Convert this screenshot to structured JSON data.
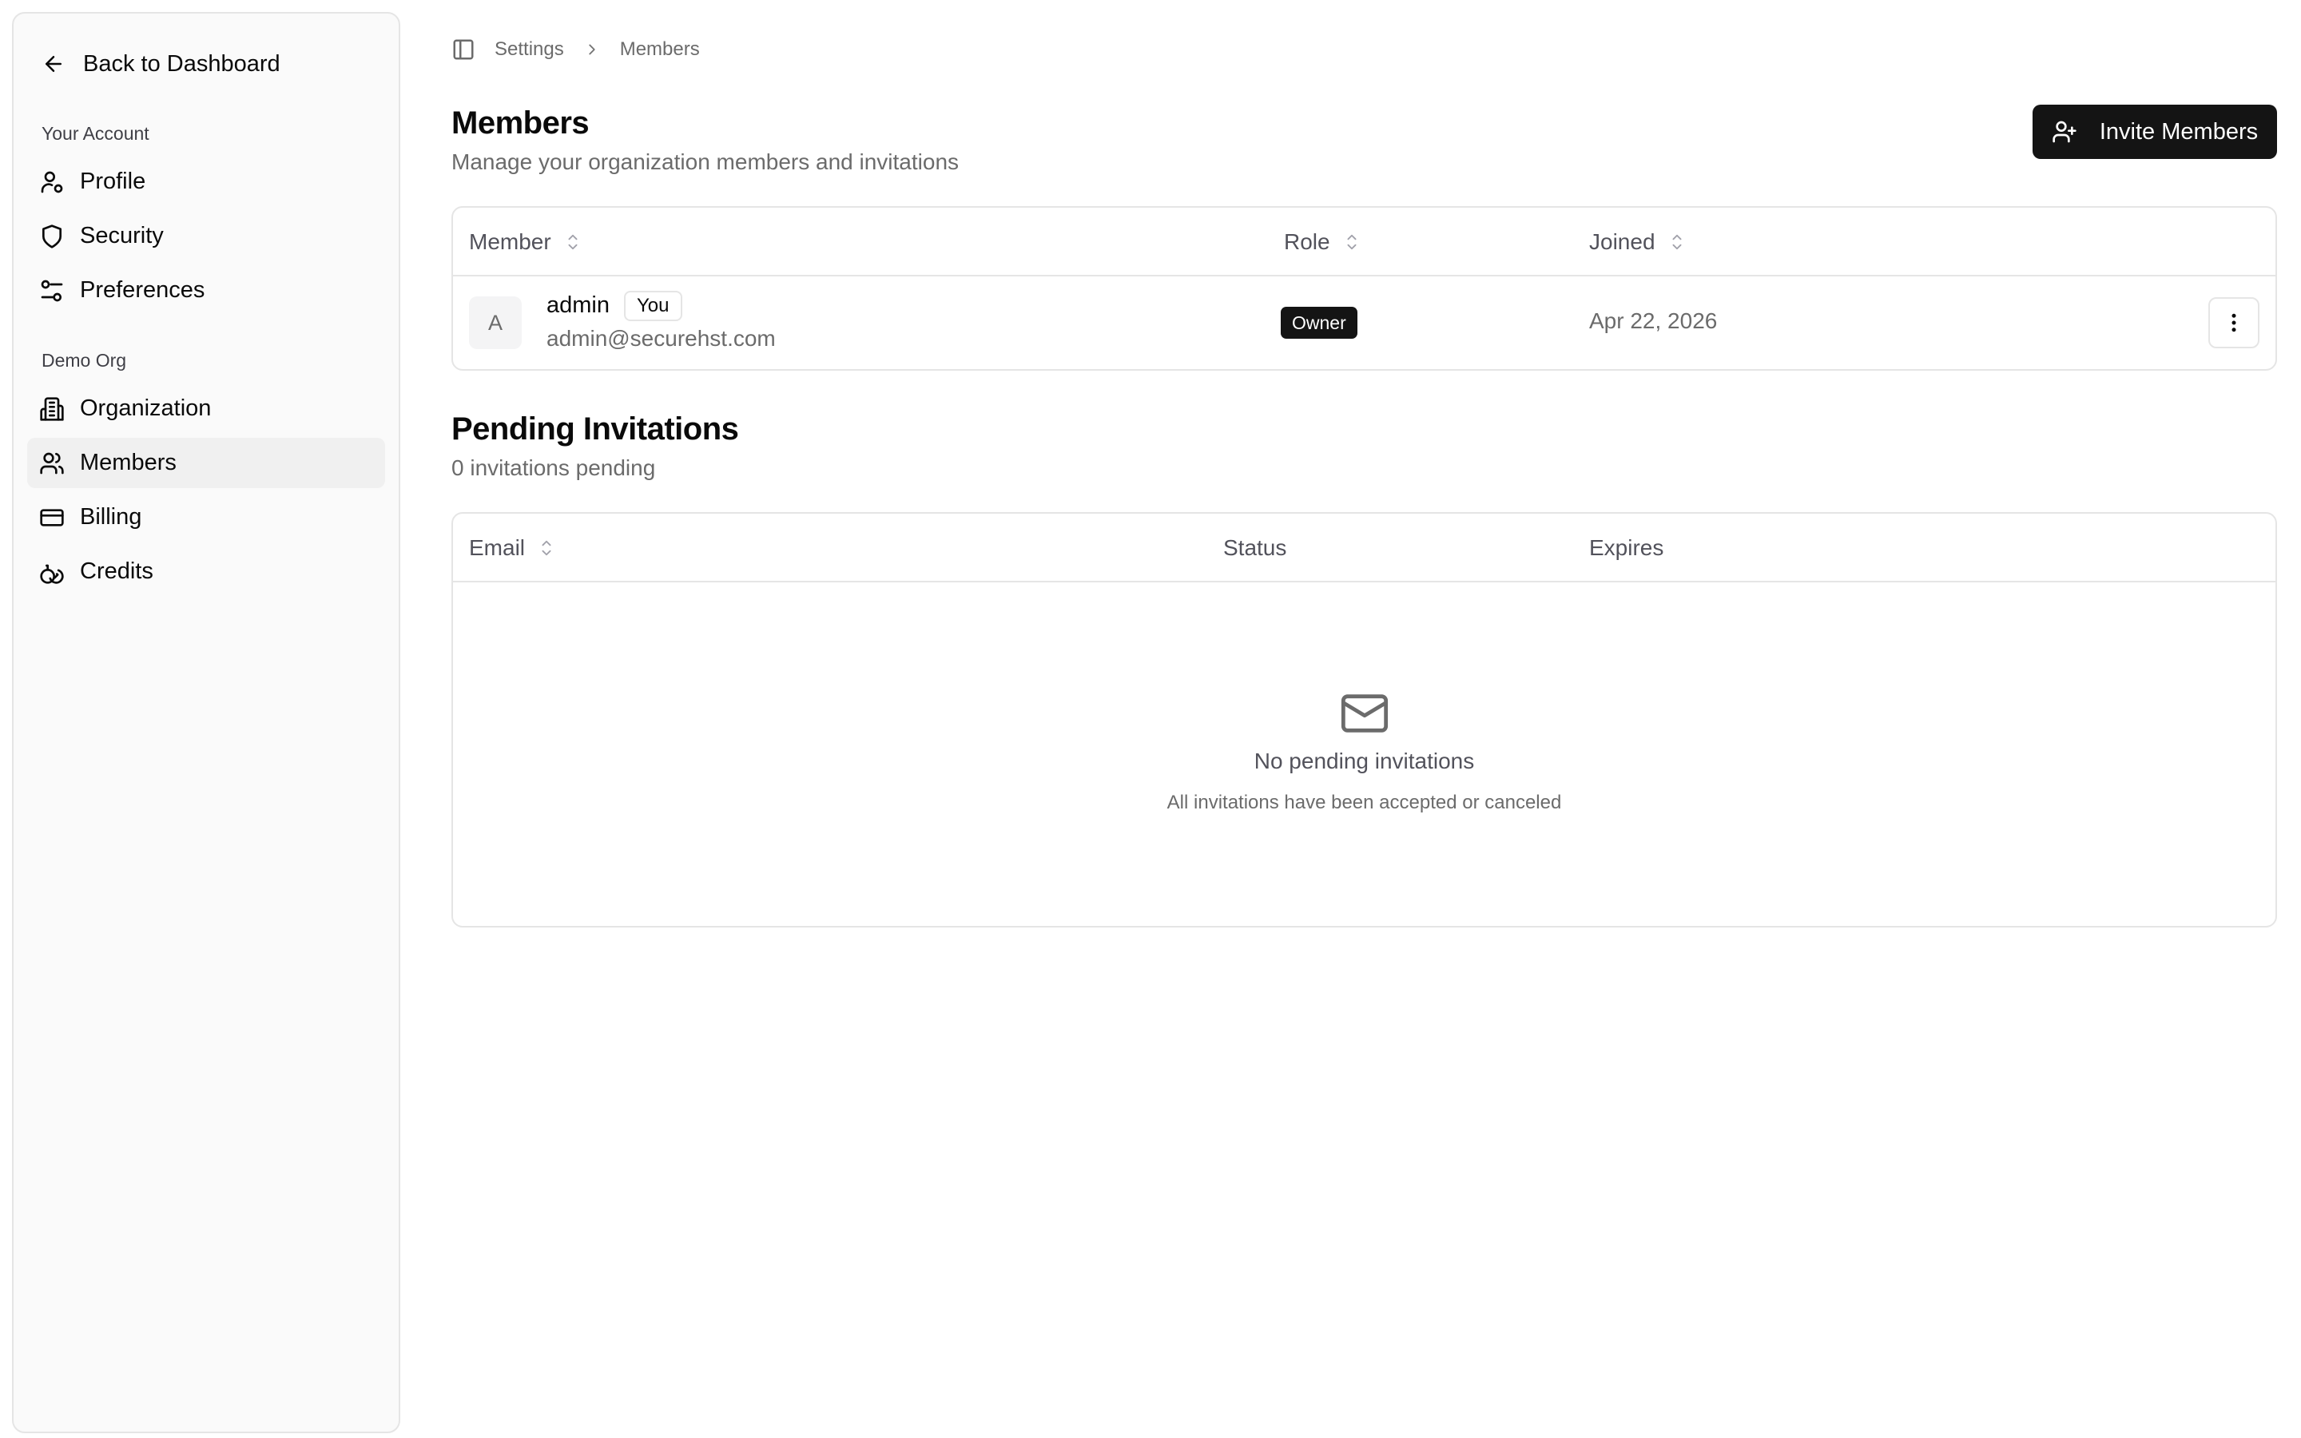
{
  "sidebar": {
    "back_label": "Back to Dashboard",
    "account_group": "Your Account",
    "account_items": [
      {
        "label": "Profile",
        "icon": "user-icon"
      },
      {
        "label": "Security",
        "icon": "shield-icon"
      },
      {
        "label": "Preferences",
        "icon": "sliders-icon"
      }
    ],
    "org_group": "Demo Org",
    "org_items": [
      {
        "label": "Organization",
        "icon": "building-icon"
      },
      {
        "label": "Members",
        "icon": "users-icon",
        "active": true
      },
      {
        "label": "Billing",
        "icon": "credit-card-icon"
      },
      {
        "label": "Credits",
        "icon": "coins-icon"
      }
    ]
  },
  "breadcrumb": {
    "items": [
      "Settings",
      "Members"
    ]
  },
  "header": {
    "title": "Members",
    "subtitle": "Manage your organization members and invitations",
    "invite_label": "Invite Members"
  },
  "members_table": {
    "columns": [
      "Member",
      "Role",
      "Joined"
    ],
    "rows": [
      {
        "initial": "A",
        "name": "admin",
        "you_badge": "You",
        "email": "admin@securehst.com",
        "role": "Owner",
        "joined": "Apr 22, 2026"
      }
    ]
  },
  "invitations": {
    "title": "Pending Invitations",
    "subtitle": "0 invitations pending",
    "columns": [
      "Email",
      "Status",
      "Expires"
    ],
    "empty_title": "No pending invitations",
    "empty_subtitle": "All invitations have been accepted or canceled"
  },
  "colors": {
    "primary": "#141414",
    "muted_text": "#6b6b6b",
    "border": "#e5e5e5",
    "sidebar_bg": "#fafafa"
  }
}
